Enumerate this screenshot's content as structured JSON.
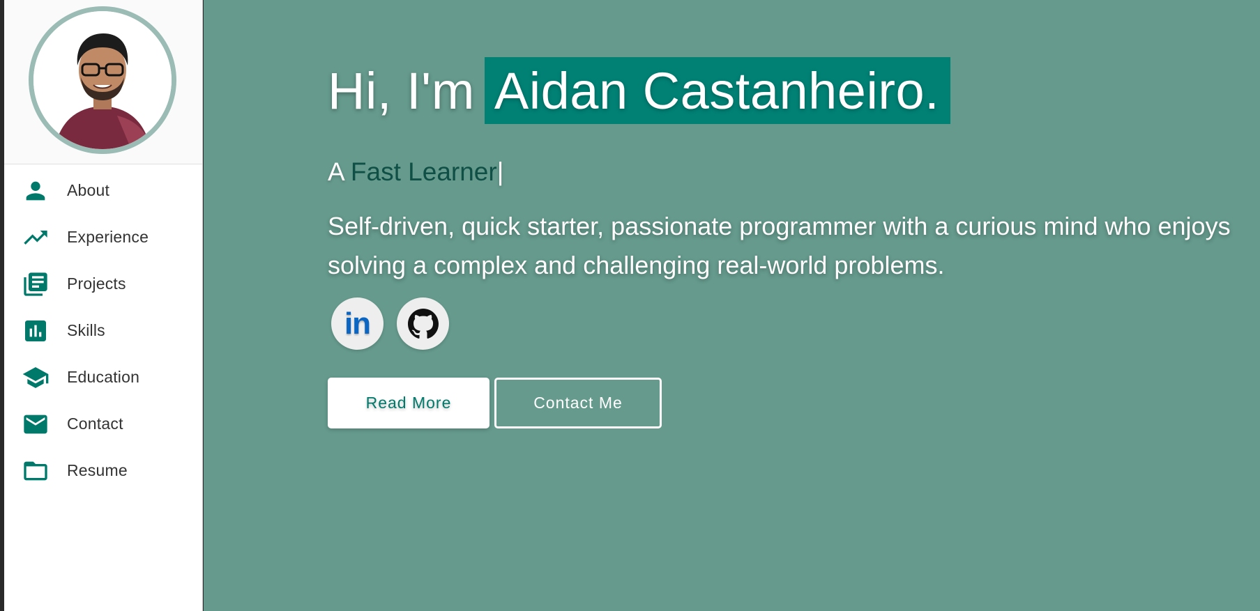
{
  "sidebar": {
    "avatar_alt": "Profile photo",
    "items": [
      {
        "label": "About",
        "icon": "person-icon"
      },
      {
        "label": "Experience",
        "icon": "trending-up-icon"
      },
      {
        "label": "Projects",
        "icon": "library-books-icon"
      },
      {
        "label": "Skills",
        "icon": "bar-chart-icon"
      },
      {
        "label": "Education",
        "icon": "graduation-cap-icon"
      },
      {
        "label": "Contact",
        "icon": "mail-icon"
      },
      {
        "label": "Resume",
        "icon": "folder-icon"
      }
    ]
  },
  "hero": {
    "greeting": "Hi, I'm",
    "name": "Aidan Castanheiro.",
    "subtitle_prefix": "A",
    "subtitle_typed": "Fast Learner",
    "subtitle_cursor": "|",
    "bio": "Self-driven, quick starter, passionate programmer with a curious mind who enjoys solving a complex and challenging real-world problems.",
    "socials": [
      {
        "name": "LinkedIn",
        "icon": "linkedin-icon",
        "glyph": "in"
      },
      {
        "name": "GitHub",
        "icon": "github-icon"
      }
    ],
    "buttons": {
      "read_more": "Read More",
      "contact_me": "Contact Me"
    }
  },
  "colors": {
    "accent": "#00796b",
    "main_bg": "#659a8c",
    "name_highlight": "#008174",
    "typed_text": "#0f4f45",
    "avatar_ring": "#9bbbb5"
  }
}
